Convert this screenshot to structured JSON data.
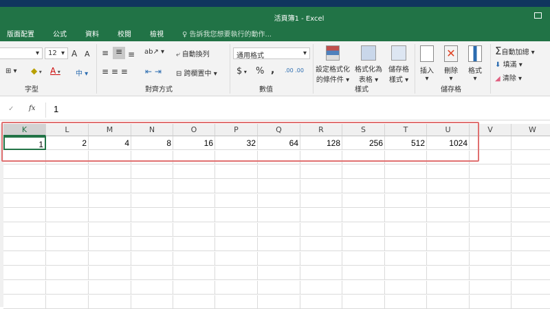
{
  "window": {
    "title": "活頁簿1 - Excel"
  },
  "tabs": [
    "版面配置",
    "公式",
    "資料",
    "校閱",
    "檢視"
  ],
  "tell_me": "告訴我您想要執行的動作...",
  "ribbon": {
    "font_size": "12",
    "grow_font": "A",
    "shrink_font": "A",
    "font_color_label": "A",
    "wrap_text": "自動換列",
    "merge_center": "跨欄置中",
    "number_format": "通用格式",
    "currency": "$",
    "percent": "%",
    "comma": ",",
    "conditional_format": [
      "設定格式化",
      "的條件件 ▾"
    ],
    "format_as_table": [
      "格式化為",
      "表格 ▾"
    ],
    "cell_styles": [
      "儲存格",
      "樣式 ▾"
    ],
    "insert": "插入",
    "delete": "刪除",
    "format": "格式",
    "autosum": "自動加總",
    "fill": "填滿",
    "clear": "清除",
    "groups": {
      "font": "字型",
      "alignment": "對齊方式",
      "number": "數值",
      "styles": "樣式",
      "cells": "儲存格"
    }
  },
  "formula_bar": {
    "fx": "fx",
    "value": "1"
  },
  "columns": [
    "K",
    "L",
    "M",
    "N",
    "O",
    "P",
    "Q",
    "R",
    "S",
    "T",
    "U",
    "V",
    "W"
  ],
  "row1": [
    "1",
    "2",
    "4",
    "8",
    "16",
    "32",
    "64",
    "128",
    "256",
    "512",
    "1024",
    "",
    ""
  ],
  "colors": {
    "accent": "#217346",
    "highlight": "#e07070"
  }
}
